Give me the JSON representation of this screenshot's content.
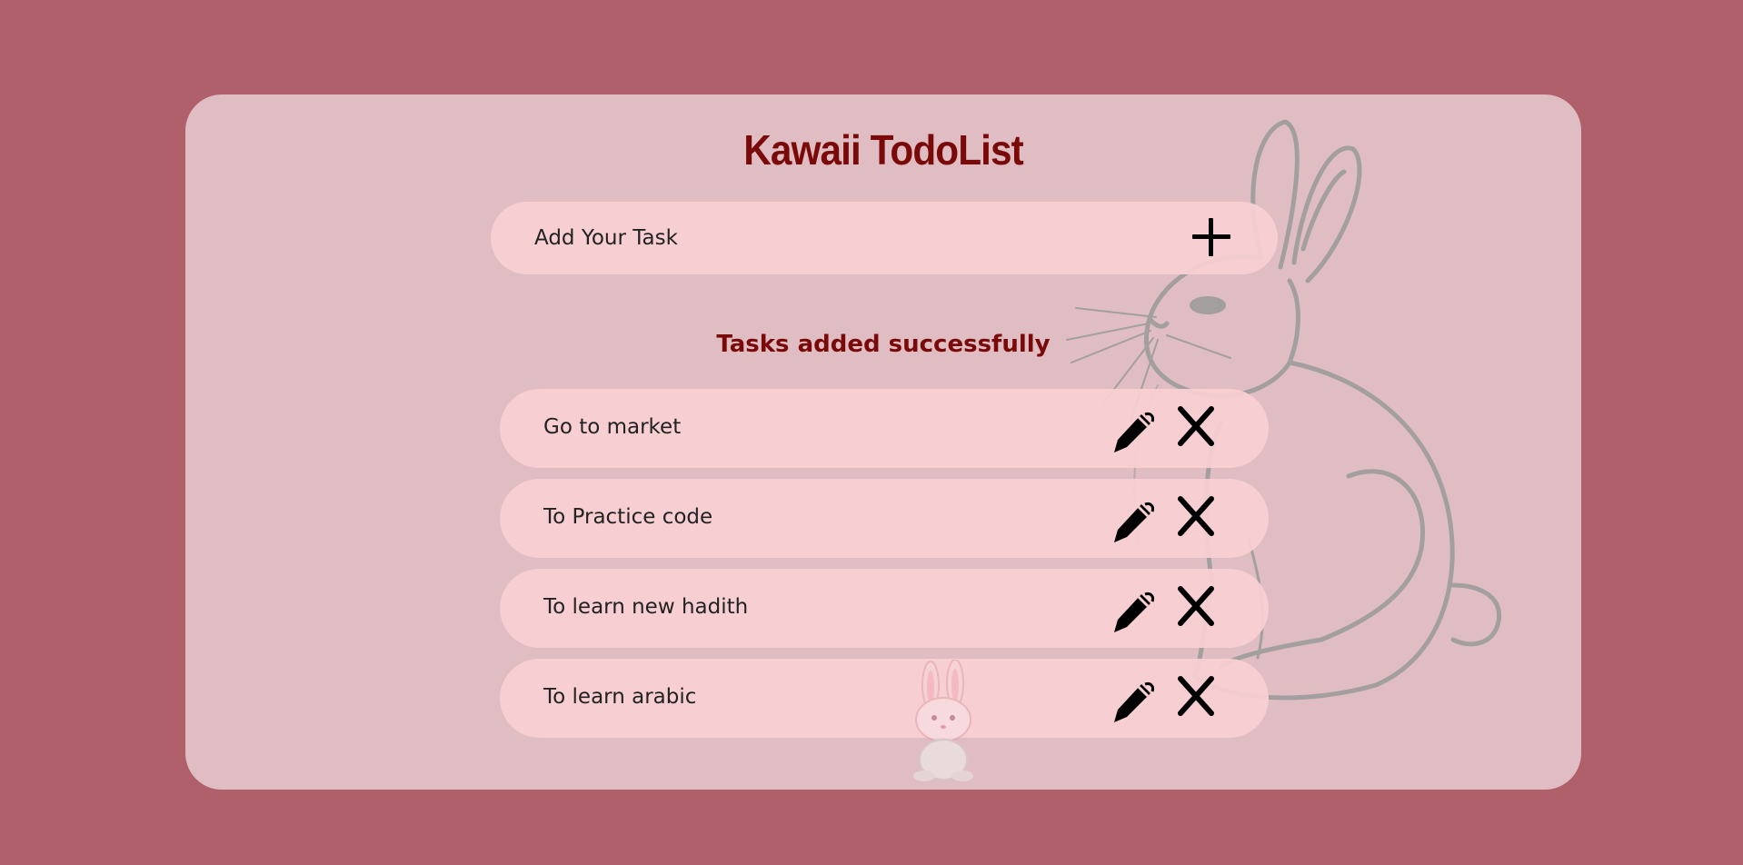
{
  "app": {
    "title": "Kawaii TodoList"
  },
  "add_task": {
    "placeholder": "Add Your Task",
    "value": "",
    "add_icon": "plus-icon"
  },
  "status_message": "Tasks added successfully",
  "tasks": [
    {
      "text": "Go to market",
      "edit_icon": "pencil-icon",
      "delete_icon": "close-icon"
    },
    {
      "text": "To Practice code",
      "edit_icon": "pencil-icon",
      "delete_icon": "close-icon"
    },
    {
      "text": "To learn new hadith",
      "edit_icon": "pencil-icon",
      "delete_icon": "close-icon"
    },
    {
      "text": "To learn arabic",
      "edit_icon": "pencil-icon",
      "delete_icon": "close-icon"
    }
  ],
  "theme": {
    "background": "#b0606b",
    "card": "#e0bdc2",
    "item": "#f9d0d4",
    "accent_text": "#7a0a0a"
  },
  "decorations": {
    "background_image": "rabbit-sketch",
    "footer_image": "small-bunny"
  }
}
